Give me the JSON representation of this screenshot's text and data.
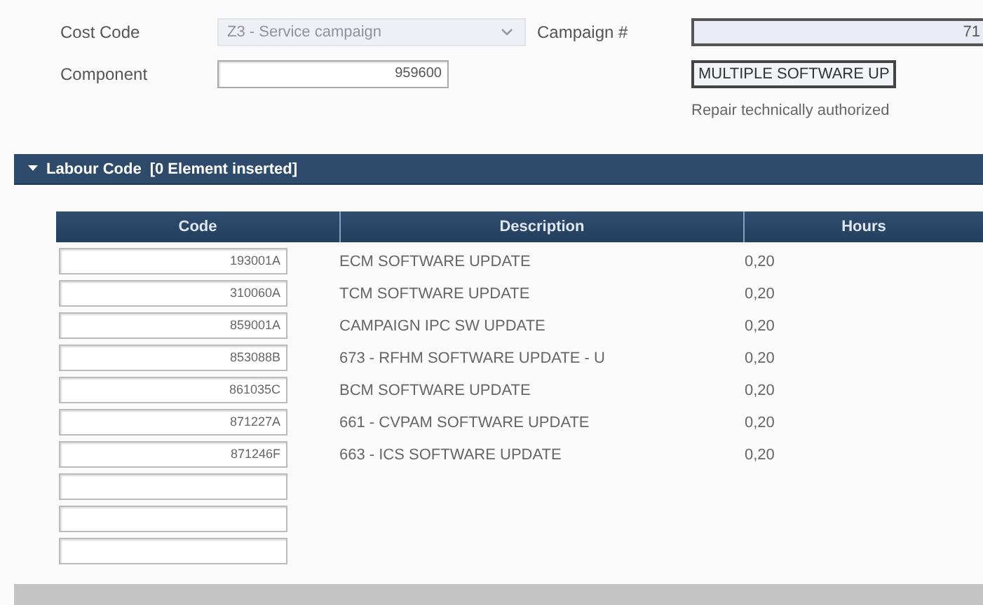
{
  "form": {
    "cost_code": {
      "label": "Cost Code",
      "value": "Z3 - Service campaign",
      "disabled": true
    },
    "campaign": {
      "label": "Campaign #",
      "value": "71"
    },
    "component": {
      "label": "Component",
      "value": "959600"
    },
    "campaign_description": {
      "value": "MULTIPLE SOFTWARE UP"
    },
    "repair_status": "Repair technically authorized"
  },
  "section": {
    "title": "Labour Code",
    "count": "[0 Element inserted]",
    "expanded": true
  },
  "table": {
    "columns": [
      "Code",
      "Description",
      "Hours"
    ],
    "rows": [
      {
        "kind": "entry",
        "code": "193001A",
        "description": "ECM SOFTWARE UPDATE",
        "hours": "0,20"
      },
      {
        "kind": "entry",
        "code": "310060A",
        "description": "TCM SOFTWARE UPDATE",
        "hours": "0,20"
      },
      {
        "kind": "entry",
        "code": "859001A",
        "description": "CAMPAIGN IPC SW UPDATE",
        "hours": "0,20"
      },
      {
        "kind": "entry",
        "code": "853088B",
        "description": "673 - RFHM SOFTWARE UPDATE - U",
        "hours": "0,20"
      },
      {
        "kind": "entry",
        "code": "861035C",
        "description": "BCM SOFTWARE UPDATE",
        "hours": "0,20"
      },
      {
        "kind": "entry",
        "code": "871227A",
        "description": "661 - CVPAM SOFTWARE UPDATE",
        "hours": "0,20"
      },
      {
        "kind": "entry",
        "code": "871246F",
        "description": "663 - ICS SOFTWARE UPDATE",
        "hours": "0,20"
      },
      {
        "kind": "blank"
      },
      {
        "kind": "blank"
      },
      {
        "kind": "blank"
      }
    ]
  }
}
